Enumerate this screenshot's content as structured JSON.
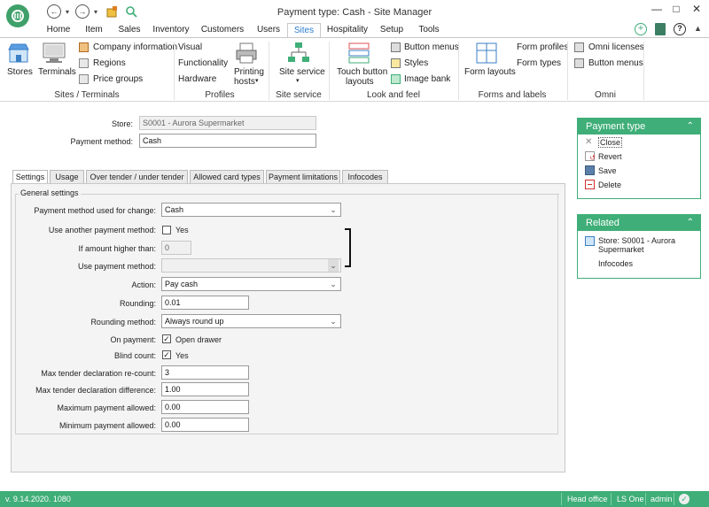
{
  "window": {
    "title": "Payment type: Cash - Site Manager"
  },
  "menu_tabs": [
    "Home",
    "Item",
    "Sales",
    "Inventory",
    "Customers",
    "Users",
    "Sites",
    "Hospitality",
    "Setup",
    "Tools"
  ],
  "active_tab": "Sites",
  "ribbon": {
    "sites_terminals": {
      "stores": "Stores",
      "terminals": "Terminals",
      "company_information": "Company information",
      "regions": "Regions",
      "price_groups": "Price groups",
      "group": "Sites / Terminals"
    },
    "profiles": {
      "visual": "Visual",
      "functionality": "Functionality",
      "hardware": "Hardware",
      "printing_hosts_line1": "Printing",
      "printing_hosts_line2": "hosts",
      "group": "Profiles"
    },
    "site_service": {
      "site_service": "Site service",
      "group": "Site service"
    },
    "look_feel": {
      "touch_button_line1": "Touch button",
      "touch_button_line2": "layouts",
      "button_menus": "Button menus",
      "styles": "Styles",
      "image_bank": "Image bank",
      "group": "Look and feel"
    },
    "forms_labels": {
      "form_layouts": "Form layouts",
      "form_profiles": "Form profiles",
      "form_types": "Form types",
      "group": "Forms and labels"
    },
    "omni": {
      "omni_licenses": "Omni licenses",
      "button_menus": "Button menus",
      "group": "Omni"
    }
  },
  "header_form": {
    "store_label": "Store:",
    "store_value": "S0001 - Aurora Supermarket",
    "payment_method_label": "Payment method:",
    "payment_method_value": "Cash"
  },
  "detail_tabs": [
    "Settings",
    "Usage",
    "Over tender / under tender",
    "Allowed card types",
    "Payment limitations",
    "Infocodes"
  ],
  "active_detail_tab": "Settings",
  "general_settings": {
    "title": "General settings",
    "payment_method_for_change_label": "Payment method used for change:",
    "payment_method_for_change_value": "Cash",
    "use_another_label": "Use another payment method:",
    "use_another_checked": false,
    "use_another_text": "Yes",
    "if_amount_higher_label": "If amount higher than:",
    "if_amount_higher_value": "0",
    "use_payment_method_label": "Use payment method:",
    "use_payment_method_value": "",
    "action_label": "Action:",
    "action_value": "Pay cash",
    "rounding_label": "Rounding:",
    "rounding_value": "0.01",
    "rounding_method_label": "Rounding method:",
    "rounding_method_value": "Always round up",
    "on_payment_label": "On payment:",
    "on_payment_checked": true,
    "on_payment_text": "Open drawer",
    "blind_count_label": "Blind count:",
    "blind_count_checked": true,
    "blind_count_text": "Yes",
    "max_recount_label": "Max tender declaration re-count:",
    "max_recount_value": "3",
    "max_difference_label": "Max tender declaration difference:",
    "max_difference_value": "1.00",
    "max_payment_label": "Maximum payment allowed:",
    "max_payment_value": "0.00",
    "min_payment_label": "Minimum payment allowed:",
    "min_payment_value": "0.00"
  },
  "payment_type_panel": {
    "title": "Payment type",
    "close": "Close",
    "revert": "Revert",
    "save": "Save",
    "delete": "Delete"
  },
  "related_panel": {
    "title": "Related",
    "store_line1": "Store: S0001 - Aurora",
    "store_line2": "Supermarket",
    "infocodes": "Infocodes"
  },
  "status_bar": {
    "version": "v. 9.14.2020. 1080",
    "office": "Head office",
    "product": "LS One",
    "user": "admin"
  },
  "colors": {
    "accent_green": "#3fae78",
    "active_tab_text": "#2a7bd0"
  }
}
